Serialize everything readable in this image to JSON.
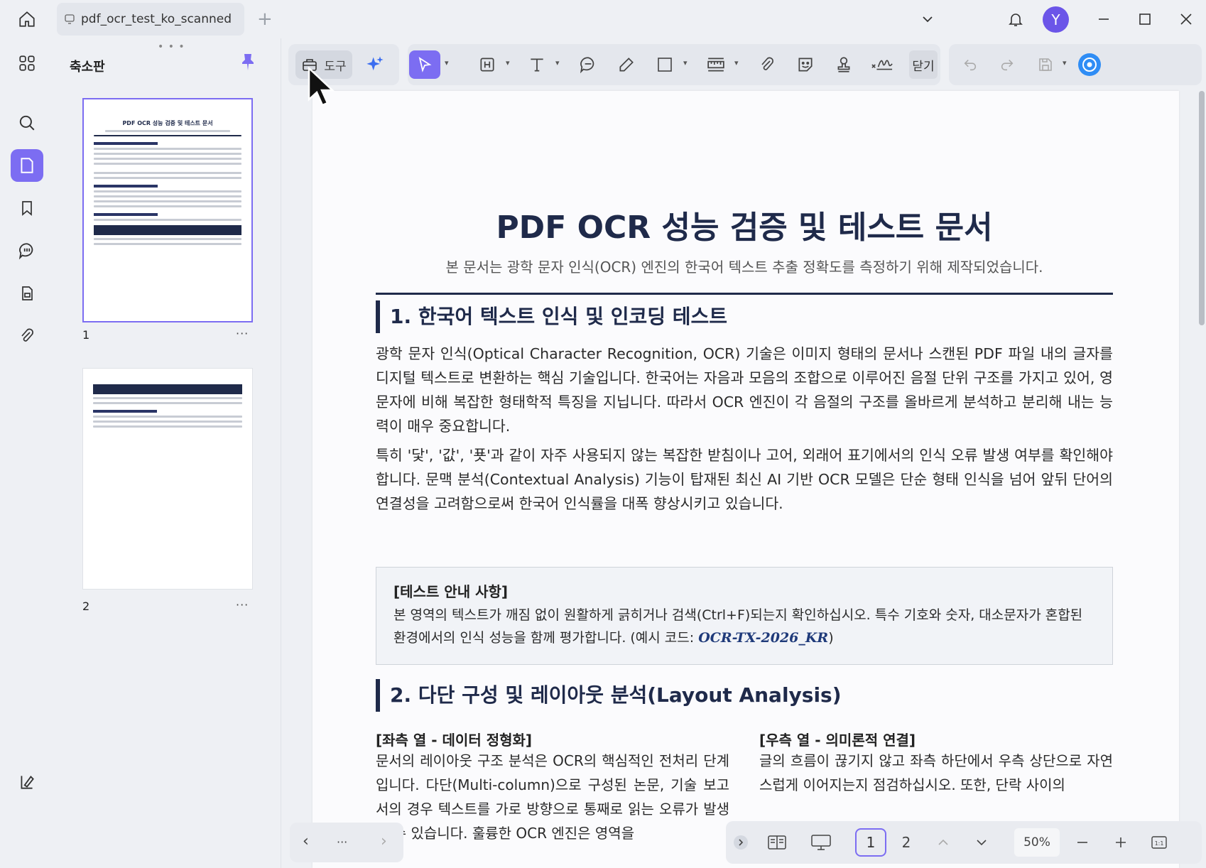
{
  "window": {
    "tab_title": "pdf_ocr_test_ko_scanned",
    "avatar_initial": "Y"
  },
  "thumbnails": {
    "panel_title": "축소판",
    "pages": [
      {
        "number": "1",
        "mini_title": "PDF OCR 성능 검증 및 테스트 문서"
      },
      {
        "number": "2"
      }
    ],
    "more": "···"
  },
  "toolbar": {
    "tools_label": "도구",
    "close_label": "닫기"
  },
  "document": {
    "title": "PDF OCR 성능 검증 및 테스트 문서",
    "subtitle": "본 문서는 광학 문자 인식(OCR) 엔진의 한국어 텍스트 추출 정확도를 측정하기 위해 제작되었습니다.",
    "section1": {
      "heading": "1. 한국어 텍스트 인식 및 인코딩 테스트",
      "para1": "광학 문자 인식(Optical Character Recognition, OCR) 기술은 이미지 형태의 문서나 스캔된 PDF 파일 내의 글자를 디지털 텍스트로 변환하는 핵심 기술입니다. 한국어는 자음과 모음의 조합으로 이루어진 음절 단위 구조를 가지고 있어, 영문자에 비해 복잡한 형태학적 특징을 지닙니다. 따라서 OCR 엔진이 각 음절의 구조를 올바르게 분석하고 분리해 내는 능력이 매우 중요합니다.",
      "para2": "특히 '닻', '값', '푯'과 같이 자주 사용되지 않는 복잡한 받침이나 고어, 외래어 표기에서의 인식 오류 발생 여부를 확인해야 합니다. 문맥 분석(Contextual Analysis) 기능이 탑재된 최신 AI 기반 OCR 모델은 단순 형태 인식을 넘어 앞뒤 단어의 연결성을 고려함으로써 한국어 인식률을 대폭 향상시키고 있습니다.",
      "notice_title": "[테스트 안내 사항]",
      "notice_body": "본 영역의 텍스트가 깨짐 없이 원활하게 긁히거나 검색(Ctrl+F)되는지 확인하십시오. 특수 기호와 숫자, 대소문자가 혼합된 환경에서의 인식 성능을 함께 평가합니다. (예시 코드: ",
      "notice_code": "OCR-TX-2026_KR",
      "notice_end": ")"
    },
    "section2": {
      "heading": "2. 다단 구성 및 레이아웃 분석(Layout Analysis)",
      "left_head": "[좌측 열 - 데이터 정형화]",
      "left_text": "문서의 레이아웃 구조 분석은 OCR의 핵심적인 전처리 단계입니다. 다단(Multi-column)으로 구성된 논문, 기술 보고서의 경우 텍스트를 가로 방향으로 통째로 읽는 오류가 발생할 수 있습니다. 훌륭한 OCR 엔진은 영역을",
      "right_head": "[우측 열 - 의미론적 연결]",
      "right_text": "글의 흐름이 끊기지 않고 좌측 하단에서 우측 상단으로 자연스럽게 이어지는지 점검하십시오. 또한, 단락 사이의"
    }
  },
  "bottom": {
    "nav_more": "···",
    "page1": "1",
    "page2": "2",
    "zoom": "50%"
  },
  "colors": {
    "accent": "#7c6df2",
    "doc_navy": "#1f2a4a"
  }
}
